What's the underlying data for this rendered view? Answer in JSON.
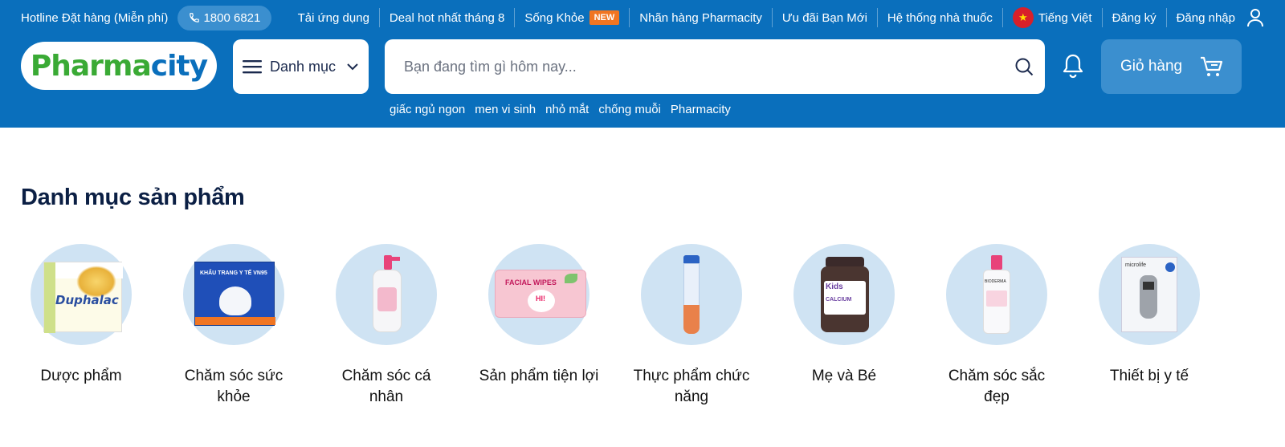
{
  "topbar": {
    "hotline_label": "Hotline Đặt hàng (Miễn phí)",
    "hotline_number": "1800 6821",
    "links": [
      {
        "label": "Tải ứng dụng"
      },
      {
        "label": "Deal hot nhất tháng 8"
      },
      {
        "label": "Sống Khỏe",
        "badge": "NEW"
      },
      {
        "label": "Nhãn hàng Pharmacity"
      },
      {
        "label": "Ưu đãi Bạn Mới"
      },
      {
        "label": "Hệ thống nhà thuốc"
      }
    ],
    "language": "Tiếng Việt",
    "register": "Đăng ký",
    "login": "Đăng nhập"
  },
  "header": {
    "logo_part1": "Pharma",
    "logo_part2": "city",
    "category_button": "Danh mục",
    "search_placeholder": "Bạn đang tìm gì hôm nay...",
    "cart_label": "Giỏ hàng",
    "suggestions": [
      "giấc ngủ ngon",
      "men vi sinh",
      "nhỏ mắt",
      "chống muỗi",
      "Pharmacity"
    ]
  },
  "section": {
    "title": "Danh mục sản phẩm",
    "categories": [
      {
        "label": "Dược phẩm"
      },
      {
        "label": "Chăm sóc sức khỏe"
      },
      {
        "label": "Chăm sóc cá nhân"
      },
      {
        "label": "Sản phẩm tiện lợi"
      },
      {
        "label": "Thực phẩm chức năng"
      },
      {
        "label": "Mẹ và Bé"
      },
      {
        "label": "Chăm sóc sắc đẹp"
      },
      {
        "label": "Thiết bị y tế"
      }
    ],
    "product_texts": {
      "duphalac": "Duphalac",
      "mask": "KHẨU TRANG Y TẾ VN95",
      "wipes": "FACIAL WIPES",
      "wipes_hi": "HI!",
      "kids": "Kids",
      "calcium": "CALCIUM",
      "bioderma": "BIODERMA",
      "microlife": "microlife"
    }
  },
  "colors": {
    "brand_blue": "#0a6fbc",
    "brand_green": "#3aaa35",
    "circle_bg": "#cfe3f3",
    "badge_orange": "#f07522"
  }
}
